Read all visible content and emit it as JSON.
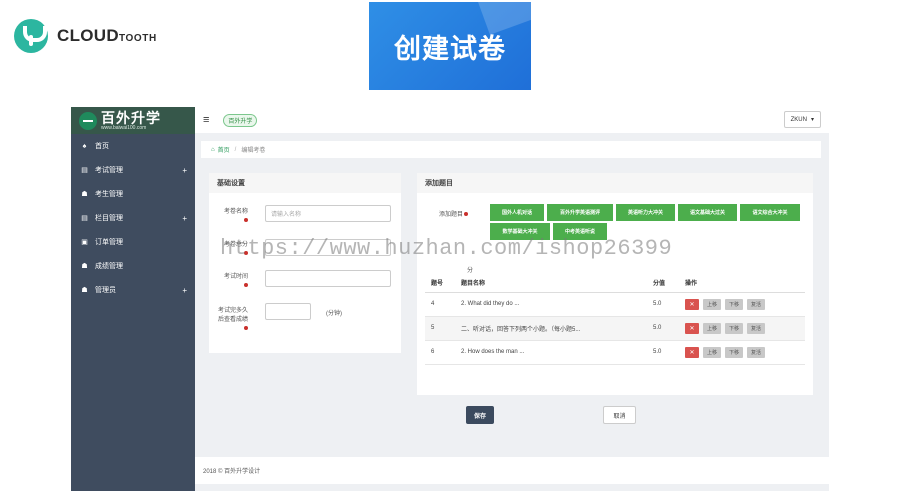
{
  "slide": {
    "brand_main": "CLOUD",
    "brand_sub": "TOOTH",
    "title": "创建试卷"
  },
  "app": {
    "logo_title": "百外升学",
    "logo_url": "www.baiwai100.com",
    "menu": [
      {
        "icon": "home-icon",
        "glyph": "♠",
        "label": "首页",
        "expandable": false
      },
      {
        "icon": "book-icon",
        "glyph": "▤",
        "label": "考试管理",
        "expandable": true
      },
      {
        "icon": "users-icon",
        "glyph": "☗",
        "label": "考生管理",
        "expandable": false
      },
      {
        "icon": "column-icon",
        "glyph": "▤",
        "label": "栏目管理",
        "expandable": true
      },
      {
        "icon": "order-icon",
        "glyph": "▣",
        "label": "订单管理",
        "expandable": false
      },
      {
        "icon": "score-icon",
        "glyph": "☗",
        "label": "成绩管理",
        "expandable": false
      },
      {
        "icon": "admin-icon",
        "glyph": "☗",
        "label": "管理员",
        "expandable": true
      }
    ],
    "menu_plus": "+",
    "topbar": {
      "hamburger": "≡",
      "site_tag": "百外升学",
      "user": "ZKUN",
      "user_caret": "▾"
    },
    "breadcrumb": {
      "home_icon": "⌂",
      "home": "首页",
      "sep": "/",
      "current": "编辑考卷"
    },
    "basic": {
      "title": "基础设置",
      "paper_name_label": "考卷名称",
      "paper_name_placeholder": "请输入名称",
      "total_label": "考卷总分",
      "time_label": "考试时间",
      "review_label": "考试完多久后查看成绩",
      "review_unit": "(分钟)"
    },
    "add": {
      "title": "添加题目",
      "type_label": "添加题目",
      "types": [
        "国外人机对话",
        "百外升学英语测评",
        "英语听力大冲关",
        "语文基础大过关",
        "语文综合大冲关",
        "数学基础大冲关",
        "中考英语听说"
      ],
      "score_unit": "分",
      "columns": [
        "题号",
        "题目名称",
        "分值",
        "操作"
      ],
      "rows": [
        {
          "no": "4",
          "name": "2. What did they do ...",
          "score": "5.0"
        },
        {
          "no": "5",
          "name": "二、听对话，回答下列两个小题。（每小题5...",
          "score": "5.0"
        },
        {
          "no": "6",
          "name": "2. How does the man ...",
          "score": "5.0"
        }
      ],
      "op_delete": "✕",
      "op_up": "上移",
      "op_down": "下移",
      "op_reset": "复活"
    },
    "save": "保存",
    "cancel": "取消",
    "footer": "2018 © 百外升学设计"
  },
  "watermark": "https://www.huzhan.com/ishop26399"
}
